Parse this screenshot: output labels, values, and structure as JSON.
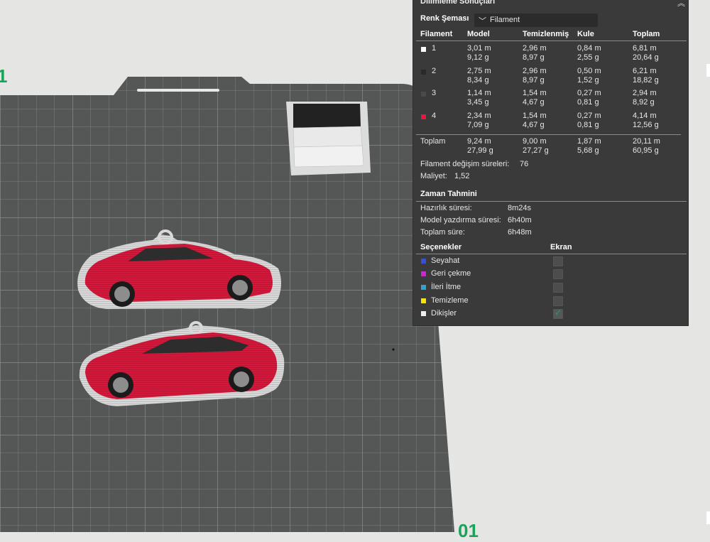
{
  "viewport": {
    "plate_labels": [
      "1",
      "01"
    ]
  },
  "panel": {
    "title": "Dilimleme Sonuçları",
    "collapse_icon": "double-chevron-up-icon",
    "color_scheme_label": "Renk Şeması",
    "color_scheme_value": "Filament",
    "headers": [
      "Filament",
      "Model",
      "Temizlenmiş",
      "Kule",
      "Toplam"
    ],
    "filaments": [
      {
        "id": "1",
        "color": "#ffffff",
        "model": [
          "3,01 m",
          "9,12 g"
        ],
        "purged": [
          "2,96 m",
          "8,97 g"
        ],
        "tower": [
          "0,84 m",
          "2,55 g"
        ],
        "total": [
          "6,81 m",
          "20,64 g"
        ]
      },
      {
        "id": "2",
        "color": "#2a2a2a",
        "model": [
          "2,75 m",
          "8,34 g"
        ],
        "purged": [
          "2,96 m",
          "8,97 g"
        ],
        "tower": [
          "0,50 m",
          "1,52 g"
        ],
        "total": [
          "6,21 m",
          "18,82 g"
        ]
      },
      {
        "id": "3",
        "color": "#4a4a4a",
        "model": [
          "1,14 m",
          "3,45 g"
        ],
        "purged": [
          "1,54 m",
          "4,67 g"
        ],
        "tower": [
          "0,27 m",
          "0,81 g"
        ],
        "total": [
          "2,94 m",
          "8,92 g"
        ]
      },
      {
        "id": "4",
        "color": "#e8173d",
        "model": [
          "2,34 m",
          "7,09 g"
        ],
        "purged": [
          "1,54 m",
          "4,67 g"
        ],
        "tower": [
          "0,27 m",
          "0,81 g"
        ],
        "total": [
          "4,14 m",
          "12,56 g"
        ]
      }
    ],
    "total_row": {
      "label": "Toplam",
      "model": [
        "9,24 m",
        "27,99 g"
      ],
      "purged": [
        "9,00 m",
        "27,27 g"
      ],
      "tower": [
        "1,87 m",
        "5,68 g"
      ],
      "total": [
        "20,11 m",
        "60,95 g"
      ]
    },
    "filament_changes_label": "Filament değişim süreleri:",
    "filament_changes_value": "76",
    "cost_label": "Maliyet:",
    "cost_value": "1,52",
    "time_title": "Zaman Tahmini",
    "time_rows": [
      {
        "label": "Hazırlık süresi:",
        "value": "8m24s"
      },
      {
        "label": "Model yazdırma süresi:",
        "value": "6h40m"
      },
      {
        "label": "Toplam süre:",
        "value": "6h48m"
      }
    ],
    "options_title": "Seçenekler",
    "display_title": "Ekran",
    "options": [
      {
        "label": "Seyahat",
        "color": "#3a4fd8",
        "checked": false
      },
      {
        "label": "Geri çekme",
        "color": "#c62ad0",
        "checked": false
      },
      {
        "label": "İleri İtme",
        "color": "#2ea3d9",
        "checked": false
      },
      {
        "label": "Temizleme",
        "color": "#f2e50f",
        "checked": false
      },
      {
        "label": "Dikişler",
        "color": "#eeeeee",
        "checked": true
      }
    ]
  }
}
